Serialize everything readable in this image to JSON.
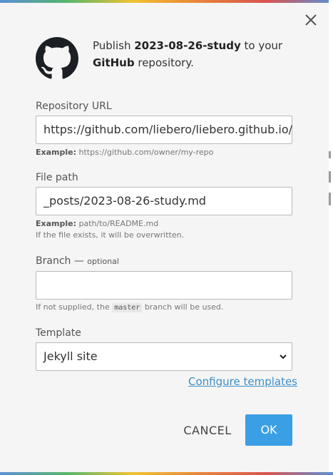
{
  "colors": {
    "accent": "#3b9fe5",
    "link": "#3d8dc7",
    "modal_bg": "#f5f5f5",
    "input_border": "#b9b9b9"
  },
  "header": {
    "icon": "github-logo-icon",
    "text_prefix": "Publish ",
    "document_name": "2023-08-26-study",
    "text_middle": " to your ",
    "service_name": "GitHub",
    "text_suffix": " repository."
  },
  "close_icon": "close-icon",
  "repository_url": {
    "label": "Repository URL",
    "value": "https://github.com/liebero/liebero.github.io/",
    "example_label": "Example:",
    "example_text": " https://github.com/owner/my-repo"
  },
  "file_path": {
    "label": "File path",
    "value": "_posts/2023-08-26-study.md",
    "example_label": "Example:",
    "example_text": " path/to/README.md",
    "note": "If the file exists, it will be overwritten."
  },
  "branch": {
    "label": "Branch",
    "label_sep": " — ",
    "optional": "optional",
    "value": "",
    "hint_prefix": "If not supplied, the ",
    "hint_code": "master",
    "hint_suffix": " branch will be used."
  },
  "template": {
    "label": "Template",
    "selected": "Jekyll site",
    "configure_link": "Configure templates"
  },
  "buttons": {
    "cancel": "CANCEL",
    "ok": "OK"
  }
}
